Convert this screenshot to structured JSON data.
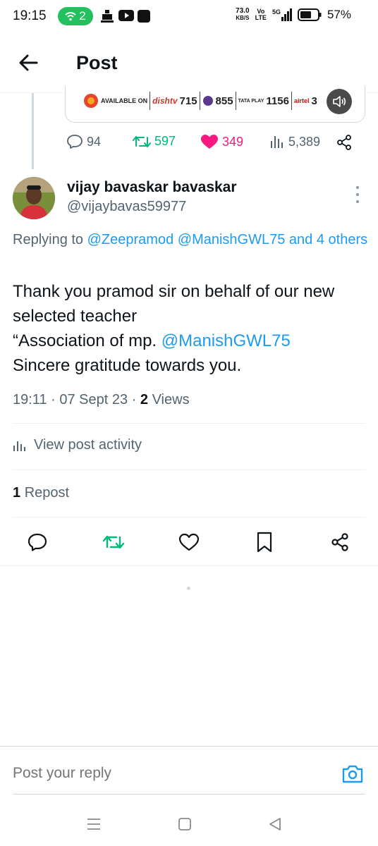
{
  "status_bar": {
    "time": "19:15",
    "hotspot_count": "2",
    "net_speed_value": "73.0",
    "net_speed_unit": "KB/S",
    "volte_top": "Vo",
    "volte_bottom": "LTE",
    "network": "5G",
    "battery_percent": "57%"
  },
  "header": {
    "title": "Post"
  },
  "prev_post": {
    "media_strip": {
      "available_on": "AVAILABLE ON",
      "dishtv_label": "dishtv",
      "dishtv_channel": "715",
      "d2h_channel": "855",
      "tataplay_label": "TATA PLAY",
      "tataplay_channel": "1156",
      "airtel_label": "airtel",
      "airtel_channel": "3"
    },
    "stats": {
      "replies": "94",
      "reposts": "597",
      "likes": "349",
      "views": "5,389"
    }
  },
  "post": {
    "author_name": "vijay bavaskar bavaskar",
    "author_handle": "@vijaybavas59977",
    "replying_prefix": "Replying to ",
    "replying_to_1": "@Zeepramod",
    "replying_to_2": "@ManishGWL75",
    "replying_suffix": "and 4 others",
    "body_line_1": "Thank you pramod sir on behalf of our new selected teacher",
    "body_line_2_prefix": "“Association of mp. ",
    "body_mention": "@ManishGWL75",
    "body_line_3": "Sincere gratitude towards you.",
    "time": "19:11",
    "date": "07 Sept 23",
    "views_count": "2",
    "views_label": "Views",
    "activity_label": "View post activity",
    "repost_count": "1",
    "repost_label": "Repost"
  },
  "reply": {
    "placeholder": "Post your reply"
  },
  "colors": {
    "accent": "#1d9bf0",
    "repost_green": "#00ba7c",
    "like_pink": "#f91880",
    "muted": "#536471"
  }
}
